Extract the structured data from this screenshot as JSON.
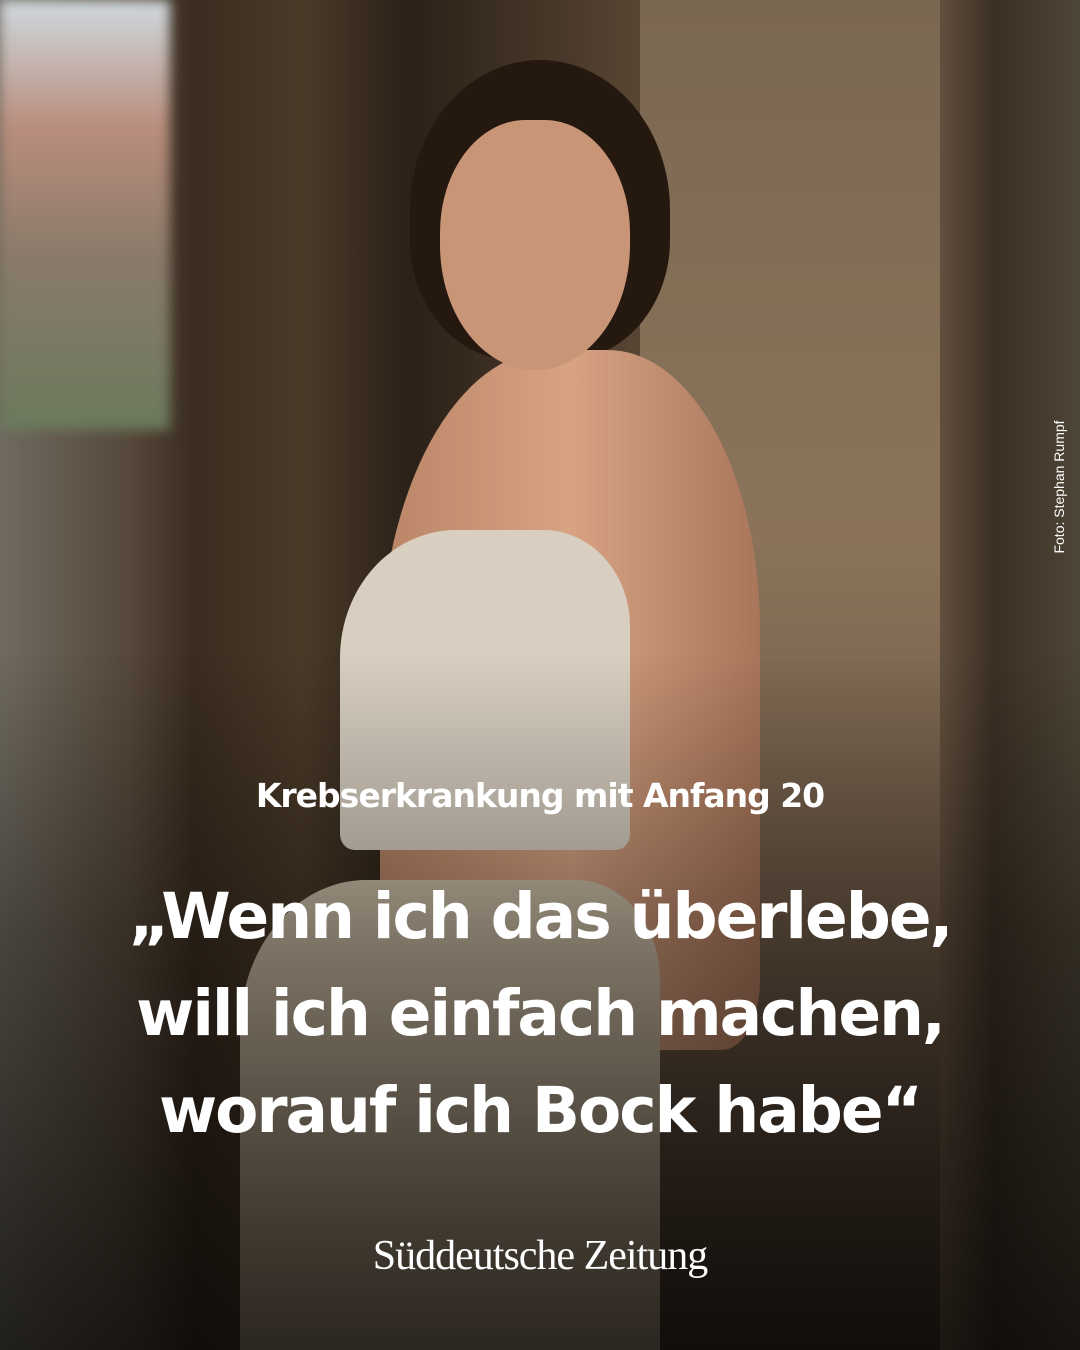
{
  "kicker": "Krebserkrankung mit Anfang 20",
  "headline": {
    "lines": [
      "„Wenn ich das überlebe,",
      "will ich einfach machen,",
      "worauf ich Bock habe“"
    ]
  },
  "photo_credit": "Foto: Stephan Rumpf",
  "logo": "Süddeutsche Zeitung",
  "colors": {
    "text": "#ffffff"
  }
}
